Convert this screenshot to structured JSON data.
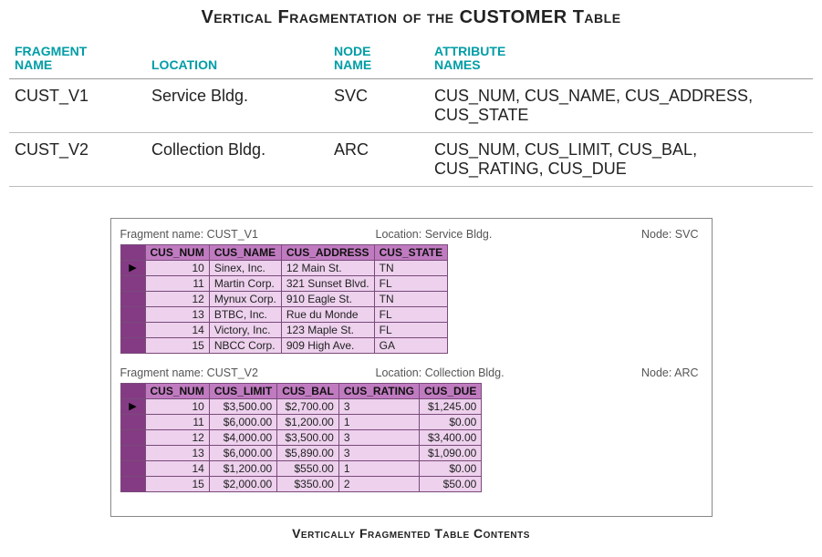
{
  "title": "Vertical Fragmentation of the CUSTOMER Table",
  "meta_headers": {
    "fragment": "FRAGMENT NAME",
    "location": "LOCATION",
    "node": "NODE NAME",
    "attributes": "ATTRIBUTE NAMES"
  },
  "meta_rows": [
    {
      "fragment": "CUST_V1",
      "location": "Service Bldg.",
      "node": "SVC",
      "attributes": "CUS_NUM, CUS_NAME, CUS_ADDRESS, CUS_STATE"
    },
    {
      "fragment": "CUST_V2",
      "location": "Collection Bldg.",
      "node": "ARC",
      "attributes": "CUS_NUM, CUS_LIMIT, CUS_BAL, CUS_RATING, CUS_DUE"
    }
  ],
  "labels": {
    "fragment_name": "Fragment name:",
    "location": "Location:",
    "node": "Node:"
  },
  "fragments": [
    {
      "name": "CUST_V1",
      "location": "Service Bldg.",
      "node": "SVC",
      "columns": [
        "CUS_NUM",
        "CUS_NAME",
        "CUS_ADDRESS",
        "CUS_STATE"
      ],
      "align": [
        "num",
        "txt",
        "txt",
        "txt"
      ],
      "rows": [
        [
          "10",
          "Sinex, Inc.",
          "12 Main St.",
          "TN"
        ],
        [
          "11",
          "Martin Corp.",
          "321 Sunset Blvd.",
          "FL"
        ],
        [
          "12",
          "Mynux Corp.",
          "910 Eagle St.",
          "TN"
        ],
        [
          "13",
          "BTBC, Inc.",
          "Rue du Monde",
          "FL"
        ],
        [
          "14",
          "Victory, Inc.",
          "123 Maple St.",
          "FL"
        ],
        [
          "15",
          "NBCC Corp.",
          "909 High Ave.",
          "GA"
        ]
      ]
    },
    {
      "name": "CUST_V2",
      "location": "Collection Bldg.",
      "node": "ARC",
      "columns": [
        "CUS_NUM",
        "CUS_LIMIT",
        "CUS_BAL",
        "CUS_RATING",
        "CUS_DUE"
      ],
      "align": [
        "num",
        "num",
        "num",
        "txt",
        "num"
      ],
      "rows": [
        [
          "10",
          "$3,500.00",
          "$2,700.00",
          "3",
          "$1,245.00"
        ],
        [
          "11",
          "$6,000.00",
          "$1,200.00",
          "1",
          "$0.00"
        ],
        [
          "12",
          "$4,000.00",
          "$3,500.00",
          "3",
          "$3,400.00"
        ],
        [
          "13",
          "$6,000.00",
          "$5,890.00",
          "3",
          "$1,090.00"
        ],
        [
          "14",
          "$1,200.00",
          "$550.00",
          "1",
          "$0.00"
        ],
        [
          "15",
          "$2,000.00",
          "$350.00",
          "2",
          "$50.00"
        ]
      ]
    }
  ],
  "caption": "Vertically Fragmented Table Contents"
}
